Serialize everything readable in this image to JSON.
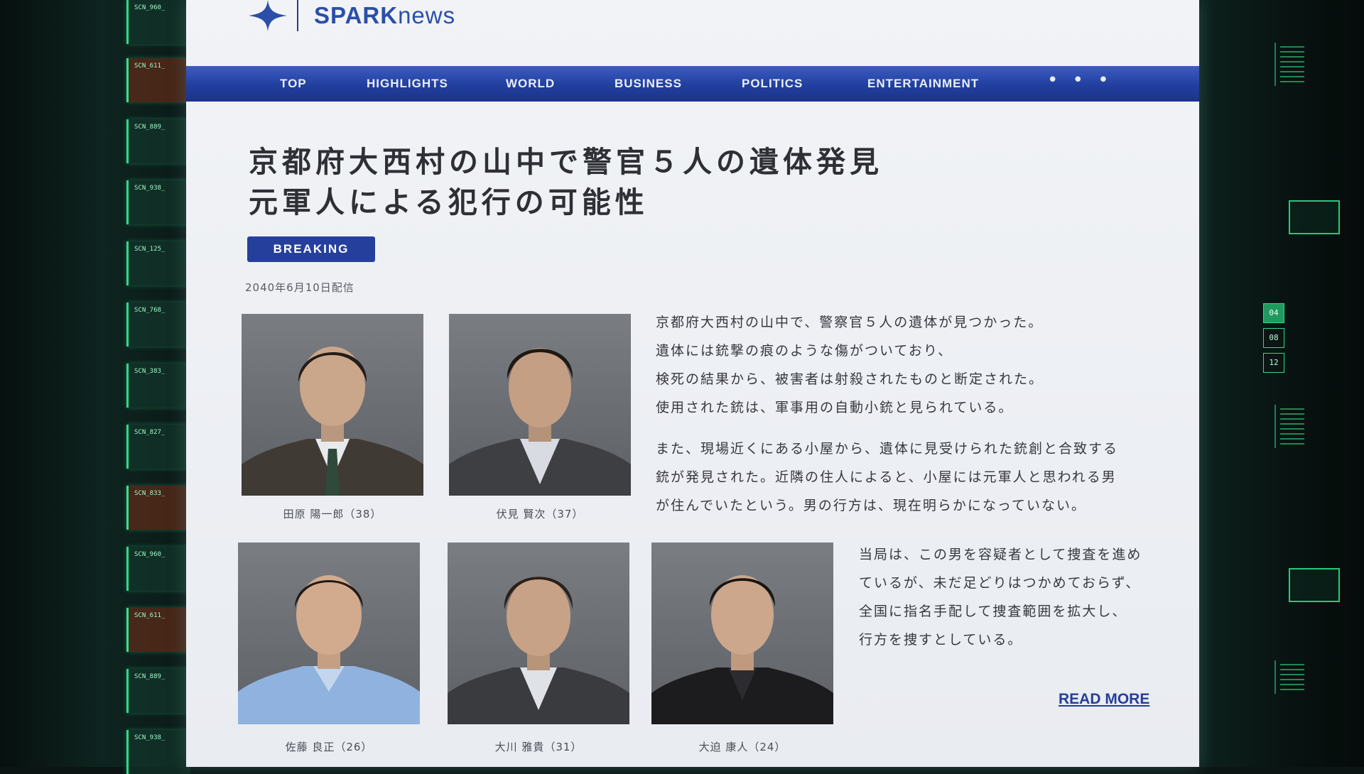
{
  "brand": {
    "name_bold": "SPARK",
    "name_rest": "news"
  },
  "nav": {
    "items": [
      "TOP",
      "HIGHLIGHTS",
      "WORLD",
      "BUSINESS",
      "POLITICS",
      "ENTERTAINMENT"
    ],
    "more": "• • •"
  },
  "article": {
    "headline_lines": [
      "京都府大西村の山中で警官５人の遺体発見",
      "元軍人による犯行の可能性"
    ],
    "badge": "BREAKING",
    "date": "2040年6月10日配信",
    "paragraph1": [
      "京都府大西村の山中で、警察官５人の遺体が見つかった。",
      "遺体には銃撃の痕のような傷がついており、",
      "検死の結果から、被害者は射殺されたものと断定された。",
      "使用された銃は、軍事用の自動小銃と見られている。"
    ],
    "paragraph2": [
      "また、現場近くにある小屋から、遺体に見受けられた銃創と合致する",
      "銃が発見された。近隣の住人によると、小屋には元軍人と思われる男",
      "が住んでいたという。男の行方は、現在明らかになっていない。"
    ],
    "paragraph3": [
      "当局は、この男を容疑者として捜査を進め",
      "ているが、未だ足どりはつかめておらず、",
      "全国に指名手配して捜査範囲を拡大し、",
      "行方を捜すとしている。"
    ],
    "read_more": "READ MORE"
  },
  "victims": [
    {
      "caption": "田原 陽一郎（38）",
      "icon": "portrait-photo"
    },
    {
      "caption": "伏見 賢次（37）",
      "icon": "portrait-photo"
    },
    {
      "caption": "佐藤 良正（26）",
      "icon": "portrait-photo"
    },
    {
      "caption": "大川 雅貴（31）",
      "icon": "portrait-photo"
    },
    {
      "caption": "大迫 康人（24）",
      "icon": "portrait-photo"
    }
  ],
  "hud": {
    "left_tiles": [
      "SCN_960_",
      "SCN_611_",
      "SCN_889_",
      "SCN_938_",
      "SCN_125_",
      "SCN_768_",
      "SCN_383_",
      "SCN_827_",
      "SCN_833_",
      "SCN_960_",
      "SCN_611_",
      "SCN_889_",
      "SCN_938_"
    ],
    "right_numbers": [
      "04",
      "08",
      "12"
    ]
  },
  "colors": {
    "brand": "#2b4ea8",
    "nav": "#213f9e",
    "hud_green": "#2fd98a"
  }
}
